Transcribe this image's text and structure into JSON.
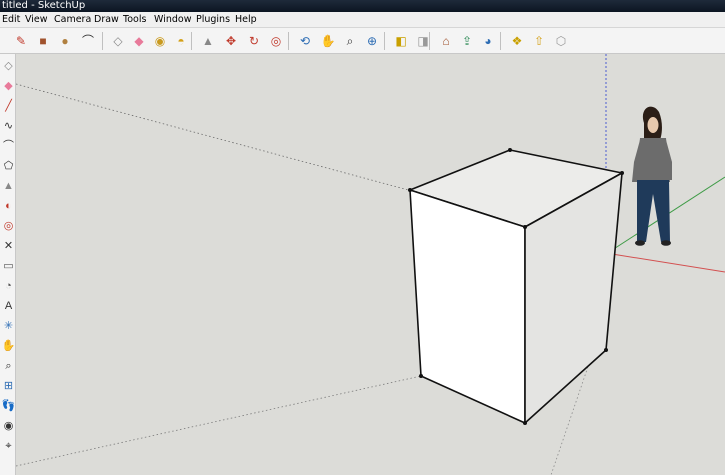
{
  "title": "titled - SketchUp",
  "menu": [
    "Edit",
    "View",
    "Camera",
    "Draw",
    "Tools",
    "Window",
    "Plugins",
    "Help"
  ],
  "toolbar_icons": [
    {
      "name": "pencil-icon",
      "glyph": "✎",
      "color": "#c0392b"
    },
    {
      "name": "rectangle-icon",
      "glyph": "■",
      "color": "#a0522d"
    },
    {
      "name": "circle-icon",
      "glyph": "●",
      "color": "#b08040"
    },
    {
      "name": "arc-icon",
      "glyph": "⌒",
      "color": "#333333"
    },
    {
      "name": "make-component-icon",
      "glyph": "◇",
      "color": "#888888"
    },
    {
      "name": "eraser-icon",
      "glyph": "◆",
      "color": "#e87a9a"
    },
    {
      "name": "tape-measure-icon",
      "glyph": "◉",
      "color": "#c99a1e"
    },
    {
      "name": "paint-bucket-icon",
      "glyph": "◓",
      "color": "#d4a017"
    },
    {
      "name": "push-pull-icon",
      "glyph": "▲",
      "color": "#888888"
    },
    {
      "name": "move-icon",
      "glyph": "✥",
      "color": "#c0392b"
    },
    {
      "name": "rotate-icon",
      "glyph": "↻",
      "color": "#c0392b"
    },
    {
      "name": "offset-icon",
      "glyph": "◎",
      "color": "#c0392b"
    },
    {
      "name": "orbit-icon",
      "glyph": "⟲",
      "color": "#2e6db4"
    },
    {
      "name": "pan-icon",
      "glyph": "✋",
      "color": "#555555"
    },
    {
      "name": "zoom-icon",
      "glyph": "⌕",
      "color": "#333333"
    },
    {
      "name": "zoom-extents-icon",
      "glyph": "⊕",
      "color": "#2e6db4"
    },
    {
      "name": "previous-view-icon",
      "glyph": "◧",
      "color": "#c9a000"
    },
    {
      "name": "next-view-icon",
      "glyph": "◨",
      "color": "#999999"
    },
    {
      "name": "get-models-icon",
      "glyph": "⌂",
      "color": "#a0522d"
    },
    {
      "name": "share-model-icon",
      "glyph": "⇪",
      "color": "#2e8b57"
    },
    {
      "name": "google-earth-icon",
      "glyph": "◕",
      "color": "#2e6db4"
    },
    {
      "name": "get-components-icon",
      "glyph": "❖",
      "color": "#c9a000"
    },
    {
      "name": "share-component-icon",
      "glyph": "⇧",
      "color": "#d4a017"
    },
    {
      "name": "extension-warehouse-icon",
      "glyph": "⬡",
      "color": "#999999"
    }
  ],
  "left_icons": [
    {
      "name": "select-icon",
      "glyph": "◇",
      "color": "#888888"
    },
    {
      "name": "eraser-icon",
      "glyph": "◆",
      "color": "#e87a9a"
    },
    {
      "name": "line-icon",
      "glyph": "╱",
      "color": "#c0392b"
    },
    {
      "name": "freehand-icon",
      "glyph": "∿",
      "color": "#333333"
    },
    {
      "name": "arc-icon",
      "glyph": "⌒",
      "color": "#333333"
    },
    {
      "name": "polygon-icon",
      "glyph": "⬠",
      "color": "#333333"
    },
    {
      "name": "push-pull-icon",
      "glyph": "▲",
      "color": "#888888"
    },
    {
      "name": "follow-me-icon",
      "glyph": "◐",
      "color": "#c0392b"
    },
    {
      "name": "offset-icon",
      "glyph": "◎",
      "color": "#c0392b"
    },
    {
      "name": "scale-icon",
      "glyph": "✕",
      "color": "#333333"
    },
    {
      "name": "dimension-icon",
      "glyph": "▭",
      "color": "#555555"
    },
    {
      "name": "protractor-icon",
      "glyph": "◔",
      "color": "#555555"
    },
    {
      "name": "text-icon",
      "glyph": "A",
      "color": "#333333"
    },
    {
      "name": "axes-icon",
      "glyph": "✳",
      "color": "#2e6db4"
    },
    {
      "name": "pan-icon",
      "glyph": "✋",
      "color": "#555555"
    },
    {
      "name": "zoom-icon",
      "glyph": "⌕",
      "color": "#333333"
    },
    {
      "name": "zoom-window-icon",
      "glyph": "⊞",
      "color": "#2e6db4"
    },
    {
      "name": "walk-icon",
      "glyph": "👣",
      "color": "#333333"
    },
    {
      "name": "look-around-icon",
      "glyph": "◉",
      "color": "#333333"
    },
    {
      "name": "position-camera-icon",
      "glyph": "⌖",
      "color": "#333333"
    }
  ],
  "colors": {
    "background": "#dcdcd8",
    "axis_red": "#d35050",
    "axis_green": "#3e9b46",
    "axis_blue": "#3b4fd0",
    "box_top": "#ececea",
    "box_front": "#ffffff",
    "box_side": "#e4e4e2"
  }
}
